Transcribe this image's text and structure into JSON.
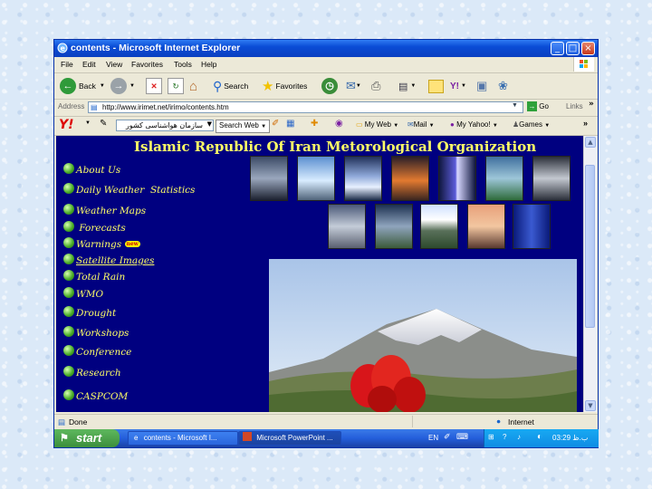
{
  "window": {
    "title": "contents - Microsoft Internet Explorer"
  },
  "menu": [
    "File",
    "Edit",
    "View",
    "Favorites",
    "Tools",
    "Help"
  ],
  "toolbar": {
    "back": "Back",
    "search": "Search",
    "favorites": "Favorites"
  },
  "address": {
    "label": "Address",
    "url": "http://www.irimet.net/irimo/contents.htm",
    "go": "Go",
    "links": "Links"
  },
  "yahoo": {
    "search_value": "سازمان هواشناسی کشور",
    "search_web": "Search Web",
    "my_web": "My Web",
    "mail": "Mail",
    "my_yahoo": "My Yahoo!",
    "games": "Games"
  },
  "page": {
    "title": "Islamic Republic Of Iran Metorological Organization",
    "nav": [
      "About Us",
      "Daily Weather  Statistics",
      "Weather Maps",
      "Forecasts",
      "Warnings",
      "Satellite Images",
      "Total Rain",
      "WMO",
      "Drought",
      "Workshops",
      "Conference",
      "Research",
      "CASPCOM"
    ],
    "new_badge": "new"
  },
  "status": {
    "text": "Done",
    "zone": "Internet"
  },
  "taskbar": {
    "start": "start",
    "tasks": [
      "contents - Microsoft I...",
      "Microsoft PowerPoint ..."
    ],
    "lang": "EN",
    "clock": "03:29 ب.ظ"
  },
  "colors": {
    "page_bg": "#000080",
    "title": "#ffff66",
    "titlebar": "#0a4cd6"
  }
}
